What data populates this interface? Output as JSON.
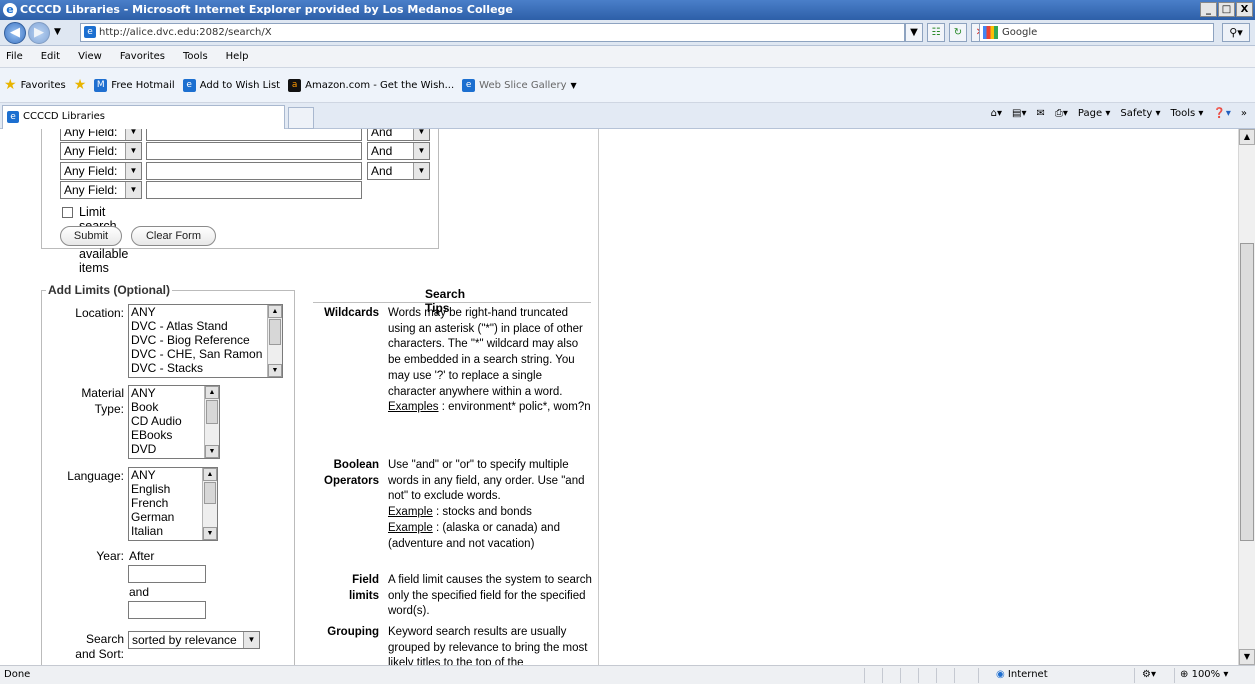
{
  "window": {
    "title": "CCCCD Libraries - Microsoft Internet Explorer provided by Los Medanos College",
    "controls": [
      "_",
      "□",
      "X"
    ]
  },
  "address": {
    "url": "http://alice.dvc.edu:2082/search/X",
    "search_placeholder": "Google"
  },
  "menu": [
    "File",
    "Edit",
    "View",
    "Favorites",
    "Tools",
    "Help"
  ],
  "favorites": {
    "label": "Favorites",
    "items": [
      "Free Hotmail",
      "Add to Wish List",
      "Amazon.com - Get the Wish...",
      "Web Slice Gallery"
    ]
  },
  "tab": {
    "title": "CCCCD Libraries"
  },
  "command_bar": [
    "Page",
    "Safety",
    "Tools"
  ],
  "search_form": {
    "field_rows": [
      {
        "field": "Any Field:",
        "op": "And"
      },
      {
        "field": "Any Field:",
        "op": "And"
      },
      {
        "field": "Any Field:",
        "op": "And"
      },
      {
        "field": "Any Field:",
        "op": ""
      }
    ],
    "limit_available": "Limit search to available items",
    "submit": "Submit",
    "clear": "Clear Form"
  },
  "limits": {
    "legend": "Add Limits (Optional)",
    "location_label": "Location:",
    "location_options": [
      "ANY",
      "DVC - Atlas Stand",
      "DVC - Biog Reference",
      "DVC - CHE, San Ramon",
      "DVC - Stacks"
    ],
    "material_label_1": "Material",
    "material_label_2": "Type:",
    "material_options": [
      "ANY",
      "Book",
      "CD Audio",
      "EBooks",
      "DVD"
    ],
    "language_label": "Language:",
    "language_options": [
      "ANY",
      "English",
      "French",
      "German",
      "Italian"
    ],
    "year_label": "Year:",
    "after_label": "After",
    "before_label": "and Before",
    "sort_label_1": "Search",
    "sort_label_2": "and Sort:",
    "sort_value": "sorted by relevance"
  },
  "tips": {
    "title": "Search Tips",
    "wildcards_term": "Wildcards",
    "wildcards_body": "Words may be right-hand truncated using an asterisk (\"*\") in place of other characters. The \"*\" wildcard may also be embedded in a search string. You may use '?' to replace a single character anywhere within a word.",
    "wildcards_ex_label": "Examples",
    "wildcards_ex_text": " : environment* polic*, wom?n",
    "boolean_term_1": "Boolean",
    "boolean_term_2": "Operators",
    "boolean_body": "Use \"and\" or \"or\" to specify multiple words in any field, any order. Use \"and not\" to exclude words.",
    "boolean_ex1_label": "Example",
    "boolean_ex1_text": " : stocks and bonds",
    "boolean_ex2_label": "Example",
    "boolean_ex2_text": " : (alaska or canada) and (adventure and not vacation)",
    "field_term_1": "Field",
    "field_term_2": "limits",
    "field_body": "A field limit causes the system to search only the specified field for the specified word(s).",
    "grouping_term": "Grouping",
    "grouping_body": "Keyword search results are usually grouped by relevance to bring the most likely titles to the top of the"
  },
  "status": {
    "text": "Done",
    "zone": "Internet",
    "zoom": "100%"
  }
}
